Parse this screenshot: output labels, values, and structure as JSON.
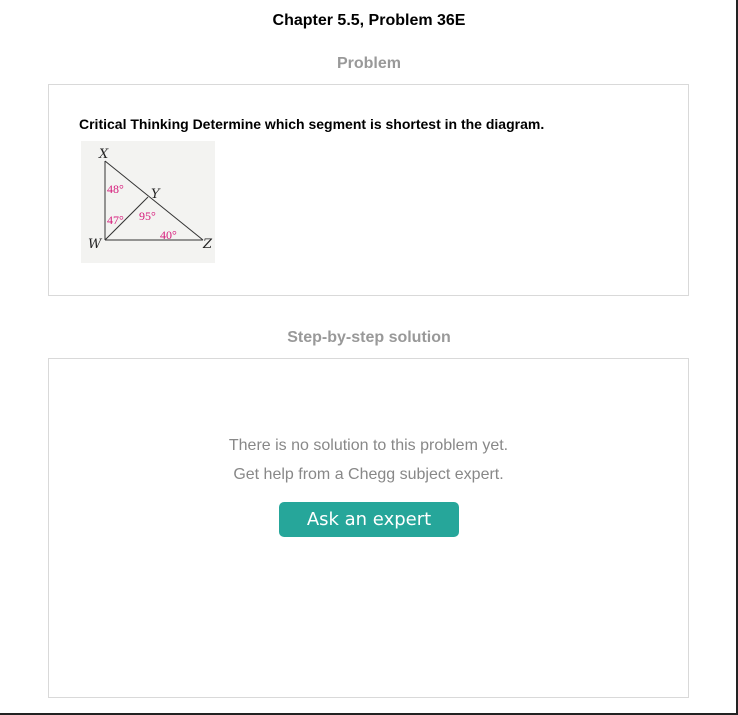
{
  "header": {
    "title": "Chapter 5.5, Problem 36E"
  },
  "problem": {
    "heading": "Problem",
    "text": "Critical Thinking Determine which segment is shortest in the diagram.",
    "diagram": {
      "vertices": {
        "x": "X",
        "y": "Y",
        "w": "W",
        "z": "Z"
      },
      "angles": {
        "a1": "48°",
        "a2": "47°",
        "a3": "95°",
        "a4": "40°"
      },
      "angle_color": "#d6197a"
    }
  },
  "solution": {
    "heading": "Step-by-step solution",
    "message_line1": "There is no solution to this problem yet.",
    "message_line2": "Get help from a Chegg subject expert.",
    "button_label": "Ask an expert",
    "button_color": "#26a69a"
  }
}
